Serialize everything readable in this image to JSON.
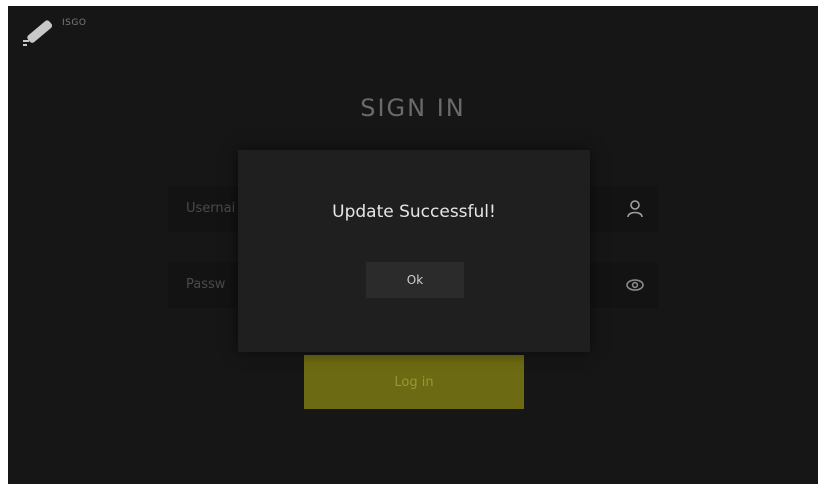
{
  "header": {
    "brand": "ISGO",
    "logo_icon": "pen-logo-icon"
  },
  "signin": {
    "title": "SIGN IN",
    "username_label": "Usernai",
    "username_icon": "user-icon",
    "password_label": "Passw",
    "password_icon": "eye-icon",
    "login_label": "Log in"
  },
  "dialog": {
    "message": "Update Successful!",
    "ok_label": "Ok"
  },
  "colors": {
    "background": "#161616",
    "dialog_background": "#1f1f1f",
    "accent": "#6c6a12"
  }
}
